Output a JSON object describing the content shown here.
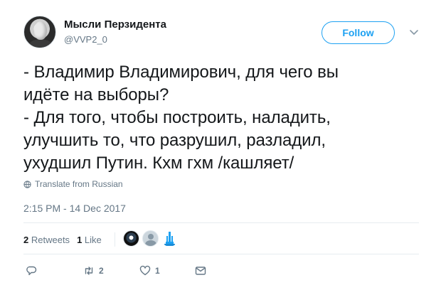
{
  "author": {
    "name": "Мысли Перзидента",
    "handle": "@VVP2_0"
  },
  "follow_label": "Follow",
  "tweet": {
    "text": "- Владимир Владимирович, для чего вы\nидёте на выборы?\n- Для того, чтобы построить, наладить,\nулучшить то, что разрушил, разладил,\nухудшил Путин. Кхм гхм /кашляет/"
  },
  "translate_label": "Translate from Russian",
  "timestamp": "2:15 PM - 14 Dec 2017",
  "stats": {
    "retweets_count": "2",
    "retweets_label": "Retweets",
    "likes_count": "1",
    "likes_label": "Like"
  },
  "actions": {
    "reply_count": "",
    "retweet_count": "2",
    "like_count": "1"
  },
  "colors": {
    "accent": "#1da1f2",
    "muted": "#657786",
    "text": "#14171a"
  },
  "icons": [
    "chevron-down-icon",
    "globe-icon",
    "reply-icon",
    "retweet-icon",
    "like-icon",
    "message-icon"
  ]
}
